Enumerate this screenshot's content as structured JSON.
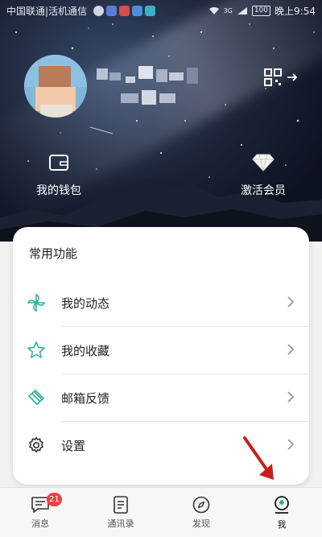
{
  "status_bar": {
    "carrier": "中国联通|活机通信",
    "time": "晚上9:54",
    "battery": "100",
    "signal_tag": "3G"
  },
  "hero": {
    "quick_actions": [
      {
        "label": "我的钱包",
        "icon": "wallet-icon"
      },
      {
        "label": "激活会员",
        "icon": "diamond-icon"
      }
    ]
  },
  "card": {
    "title": "常用功能",
    "items": [
      {
        "label": "我的动态",
        "icon": "pinwheel-icon"
      },
      {
        "label": "我的收藏",
        "icon": "star-icon"
      },
      {
        "label": "邮箱反馈",
        "icon": "mail-feedback-icon"
      },
      {
        "label": "设置",
        "icon": "gear-icon"
      }
    ]
  },
  "tabbar": {
    "tabs": [
      {
        "label": "消息",
        "icon": "message-icon",
        "badge": "21"
      },
      {
        "label": "通讯录",
        "icon": "contacts-icon"
      },
      {
        "label": "发现",
        "icon": "compass-icon"
      },
      {
        "label": "我",
        "icon": "profile-icon",
        "active": true
      }
    ]
  },
  "colors": {
    "accent": "#2bb3a0",
    "badge": "#f04040",
    "annotation_arrow": "#c81e1e"
  }
}
